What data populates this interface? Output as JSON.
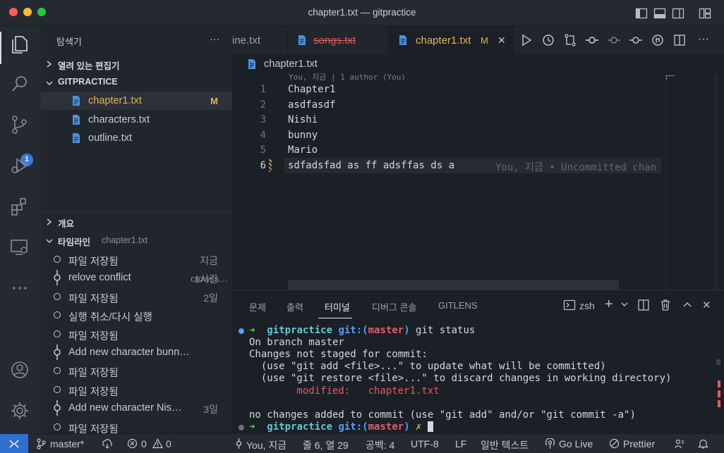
{
  "window": {
    "title": "chapter1.txt — gitpractice"
  },
  "activity": {
    "scm_badge": "1"
  },
  "explorer": {
    "header": "탐색기",
    "more": "···",
    "open_editors": "열려 있는 편집기",
    "folder": "GITPRACTICE",
    "files": [
      {
        "name": "chapter1.txt",
        "badge": "M"
      },
      {
        "name": "characters.txt",
        "badge": ""
      },
      {
        "name": "outline.txt",
        "badge": ""
      }
    ],
    "outline": "개요",
    "timeline": "타임라인",
    "timeline_file": "chapter1.txt"
  },
  "timeline": [
    {
      "label": "파일 저장됨",
      "sub": "",
      "time": "지금",
      "kind": "save"
    },
    {
      "label": "relove conflict",
      "sub": "crowss…",
      "time": "1시간",
      "kind": "commit"
    },
    {
      "label": "파일 저장됨",
      "sub": "",
      "time": "2일",
      "kind": "save"
    },
    {
      "label": "실행 취소/다시 실행",
      "sub": "",
      "time": "",
      "kind": "save"
    },
    {
      "label": "파일 저장됨",
      "sub": "",
      "time": "",
      "kind": "save"
    },
    {
      "label": " Add new character bunn…",
      "sub": "",
      "time": "",
      "kind": "commit"
    },
    {
      "label": "파일 저장됨",
      "sub": "",
      "time": "",
      "kind": "save"
    },
    {
      "label": "파일 저장됨",
      "sub": "",
      "time": "",
      "kind": "save"
    },
    {
      "label": "Add new character Nis…",
      "sub": "",
      "time": "3일",
      "kind": "commit"
    },
    {
      "label": "파일 저장됨",
      "sub": "",
      "time": "",
      "kind": "save"
    }
  ],
  "tabs": {
    "partial": "ine.txt",
    "deleted": "songs.txt",
    "active": "chapter1.txt",
    "active_badge": "M",
    "close": "✕"
  },
  "breadcrumb": "chapter1.txt",
  "editor": {
    "codelens": "You, 지금 | 1 author (You)",
    "lines": [
      {
        "n": "1",
        "text": "Chapter1"
      },
      {
        "n": "2",
        "text": "asdfasdf"
      },
      {
        "n": "3",
        "text": "Nishi"
      },
      {
        "n": "4",
        "text": "bunny"
      },
      {
        "n": "5",
        "text": "Mario"
      },
      {
        "n": "6",
        "text": "sdfadsfad as ff adsffas ds a"
      }
    ],
    "blame": "You, 지금 • Uncommitted chan"
  },
  "panel": {
    "tabs": [
      "문제",
      "출력",
      "터미널",
      "디버그 콘솔",
      "GITLENS"
    ],
    "shell": "zsh",
    "terminal": [
      {
        "kind": "prompt",
        "dir": "gitpractice",
        "git": "git:(",
        "branch": "master",
        "close": ")",
        "cmd": " git status"
      },
      {
        "kind": "text",
        "text": "On branch master"
      },
      {
        "kind": "text",
        "text": "Changes not staged for commit:"
      },
      {
        "kind": "text",
        "text": "  (use \"git add <file>...\" to update what will be committed)"
      },
      {
        "kind": "text",
        "text": "  (use \"git restore <file>...\" to discard changes in working directory)"
      },
      {
        "kind": "mod",
        "label": "        modified:   ",
        "file": "chapter1.txt"
      },
      {
        "kind": "text",
        "text": ""
      },
      {
        "kind": "text",
        "text": "no changes added to commit (use \"git add\" and/or \"git commit -a\")"
      },
      {
        "kind": "prompt2",
        "dir": "gitpractice",
        "git": "git:(",
        "branch": "master",
        "close": ")",
        "x": " ✗ "
      }
    ]
  },
  "status": {
    "branch": "master*",
    "errors": "0",
    "warnings": "0",
    "blame": "You, 지금",
    "position": "줄 6, 열 29",
    "spaces": "공백: 4",
    "encoding": "UTF-8",
    "eol": "LF",
    "language": "일반 텍스트",
    "golive": "Go Live",
    "prettier": "Prettier"
  },
  "colors": {
    "accent": "#3b78e0",
    "modified": "#e1b455",
    "deleted": "#e05d5d",
    "prompt_green": "#5fcf6f",
    "prompt_blue": "#4fa0ff",
    "branch_red": "#e35d6a"
  }
}
